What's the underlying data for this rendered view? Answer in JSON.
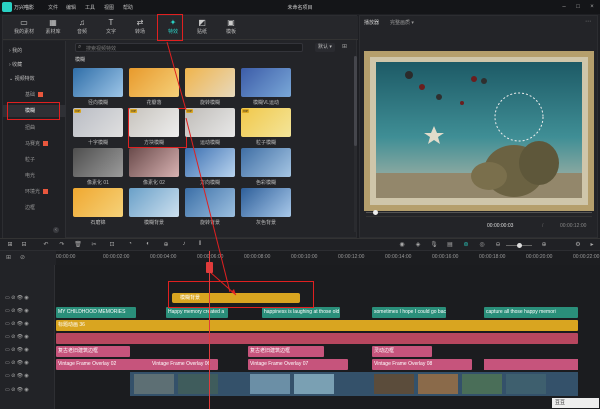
{
  "app": {
    "name": "万兴喵影",
    "project_title": "未命名项目"
  },
  "menu": [
    "文件",
    "编辑",
    "工具",
    "视图",
    "帮助"
  ],
  "tabs": [
    {
      "label": "我的素材",
      "icon": "folder-icon"
    },
    {
      "label": "素材库",
      "icon": "library-icon"
    },
    {
      "label": "音频",
      "icon": "music-icon"
    },
    {
      "label": "文字",
      "icon": "text-icon"
    },
    {
      "label": "转场",
      "icon": "transition-icon"
    },
    {
      "label": "特效",
      "icon": "effects-icon",
      "active": true
    },
    {
      "label": "贴纸",
      "icon": "sticker-icon"
    },
    {
      "label": "模板",
      "icon": "template-icon"
    }
  ],
  "sidebar": [
    {
      "label": "我的",
      "level": 0
    },
    {
      "label": "收藏",
      "level": 0
    },
    {
      "label": "视频特效",
      "level": 0
    },
    {
      "label": "基础",
      "level": 1,
      "new": true
    },
    {
      "label": "模糊",
      "level": 1,
      "active": true
    },
    {
      "label": "扭曲",
      "level": 1
    },
    {
      "label": "马赛克",
      "level": 1,
      "new": true
    },
    {
      "label": "粒子",
      "level": 1
    },
    {
      "label": "电光",
      "level": 1
    },
    {
      "label": "环境光",
      "level": 1,
      "new": true
    },
    {
      "label": "边框",
      "level": 1
    }
  ],
  "search": {
    "placeholder": "搜索视频特效",
    "sort": "默认"
  },
  "section_title": "模糊",
  "effects": [
    {
      "label": "径向模糊"
    },
    {
      "label": "花瓣落"
    },
    {
      "label": "旋转模糊"
    },
    {
      "label": "模糊VL运动"
    },
    {
      "label": "十字模糊",
      "badge": "VIP"
    },
    {
      "label": "方块模糊",
      "badge": "VIP"
    },
    {
      "label": "运动模糊",
      "badge": "VIP"
    },
    {
      "label": "粒子模糊",
      "badge": "VIP"
    },
    {
      "label": "像素化 01"
    },
    {
      "label": "像素化 02"
    },
    {
      "label": "方向模糊"
    },
    {
      "label": "色彩模糊"
    },
    {
      "label": "石磨锦"
    },
    {
      "label": "模糊背景"
    },
    {
      "label": "旋转背景"
    },
    {
      "label": "灰色背景"
    }
  ],
  "preview": {
    "label": "播放器",
    "quality": "完整画质",
    "current_time": "00:00:00:03",
    "total_time": "00:00:12:00",
    "progress": 0.03
  },
  "ruler_times": [
    "00:00:00",
    "00:00:02:00",
    "00:00:04:00",
    "00:00:06:00",
    "00:00:08:00",
    "00:00:10:00",
    "00:00:12:00",
    "00:00:14:00",
    "00:00:16:00",
    "00:00:18:00",
    "00:00:20:00",
    "00:00:22:00"
  ],
  "timeline": {
    "drag_clip": "模糊背景",
    "clips": {
      "teal_a": "MY CHILDHOOD MEMORIES",
      "teal_b": "Happy memory created a",
      "teal_c": "happiness is laughing at those old",
      "teal_d": "sometimes I hope I could go back",
      "teal_e": "capture all those happy memori",
      "gold": "标题动画 36",
      "pink_a": "复古老旧建筑边框",
      "pink_b": "复古老旧建筑边框",
      "pink_c": "灵动边框",
      "pink_d": "Vintage Frame Overlay 02",
      "pink_e": "Vintage Frame Overlay 06",
      "pink_f": "Vintage Frame Overlay 07",
      "pink_g": "Vintage Frame Overlay 08"
    }
  },
  "brand_tag": "豆豆"
}
